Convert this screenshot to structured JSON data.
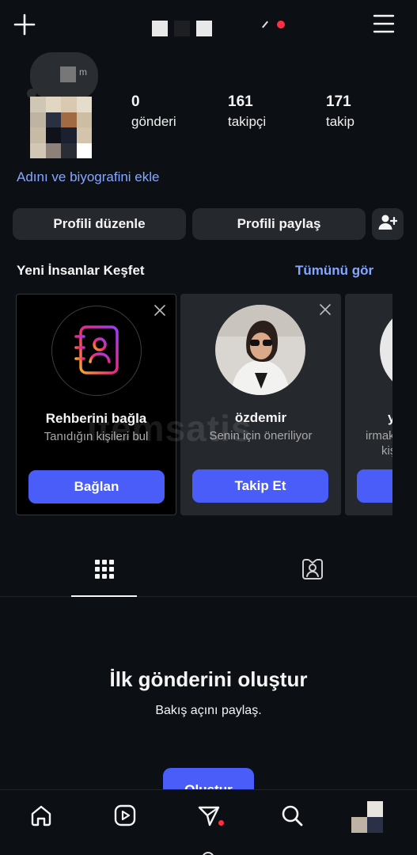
{
  "header": {
    "plus_icon": "plus-icon",
    "menu_icon": "hamburger-menu-icon",
    "notification_color": "#ff3040"
  },
  "note": {
    "text": "m"
  },
  "profile": {
    "stats": [
      {
        "value": "0",
        "label": "gönderi"
      },
      {
        "value": "161",
        "label": "takipçi"
      },
      {
        "value": "171",
        "label": "takip"
      }
    ],
    "add_bio_link": "Adını ve biyografini ekle",
    "edit_button": "Profili düzenle",
    "share_button": "Profili paylaş",
    "add_person_icon": "add-person-icon"
  },
  "discover": {
    "title": "Yeni İnsanlar Keşfet",
    "see_all": "Tümünü gör",
    "cards": [
      {
        "name": "Rehberini bağla",
        "subtitle": "Tanıdığın kişileri bul",
        "button": "Bağlan",
        "icon": "contacts-book-icon"
      },
      {
        "name": "özdemir",
        "subtitle": "Senin için öneriliyor",
        "button": "Takip Et"
      },
      {
        "name": "y",
        "subtitle": "irmak",
        "subtitle2": "kiş",
        "button": ""
      }
    ]
  },
  "watermark": "itemsatis",
  "tabs": [
    {
      "icon": "grid-icon",
      "active": true
    },
    {
      "icon": "tagged-person-icon",
      "active": false
    }
  ],
  "empty_state": {
    "title": "İlk gönderini oluştur",
    "subtitle": "Bakış açını paylaş.",
    "button": "Oluştur"
  },
  "bottom_nav": [
    {
      "icon": "home-icon"
    },
    {
      "icon": "reels-icon"
    },
    {
      "icon": "send-icon",
      "badge": true
    },
    {
      "icon": "search-icon"
    },
    {
      "icon": "profile-avatar"
    }
  ],
  "colors": {
    "background": "#0c1014",
    "button_gray": "#25292e",
    "accent_blue": "#4a5df9",
    "link_blue": "#85a7ff",
    "badge_red": "#ff3040"
  }
}
